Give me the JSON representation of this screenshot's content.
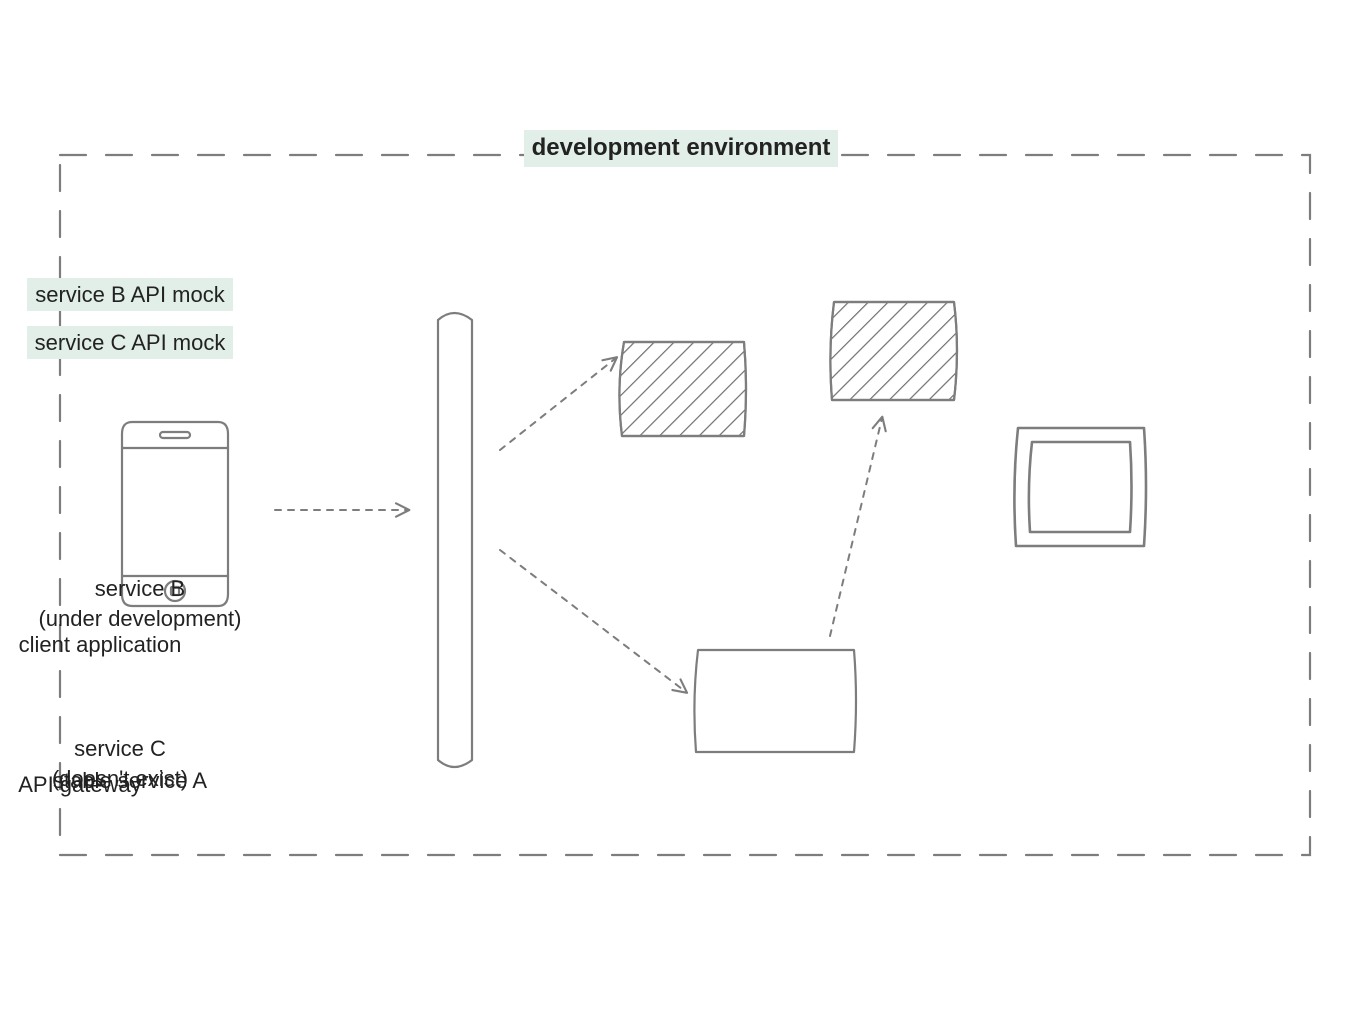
{
  "title": "development environment",
  "nodes": {
    "client": {
      "label": "client application"
    },
    "gateway": {
      "label": "API gateway"
    },
    "mockC": {
      "label": "service C API mock"
    },
    "mockB": {
      "label": "service B API mock"
    },
    "serviceA": {
      "label": "stable service A"
    },
    "serviceB": {
      "label": "service B\n(under development)"
    },
    "serviceC": {
      "label": "service C\n(doesn't exist)"
    }
  },
  "colors": {
    "stroke": "#7d7d7d",
    "hatch": "#6f6f6f",
    "highlight": "#e2efe9",
    "text": "#222222"
  }
}
